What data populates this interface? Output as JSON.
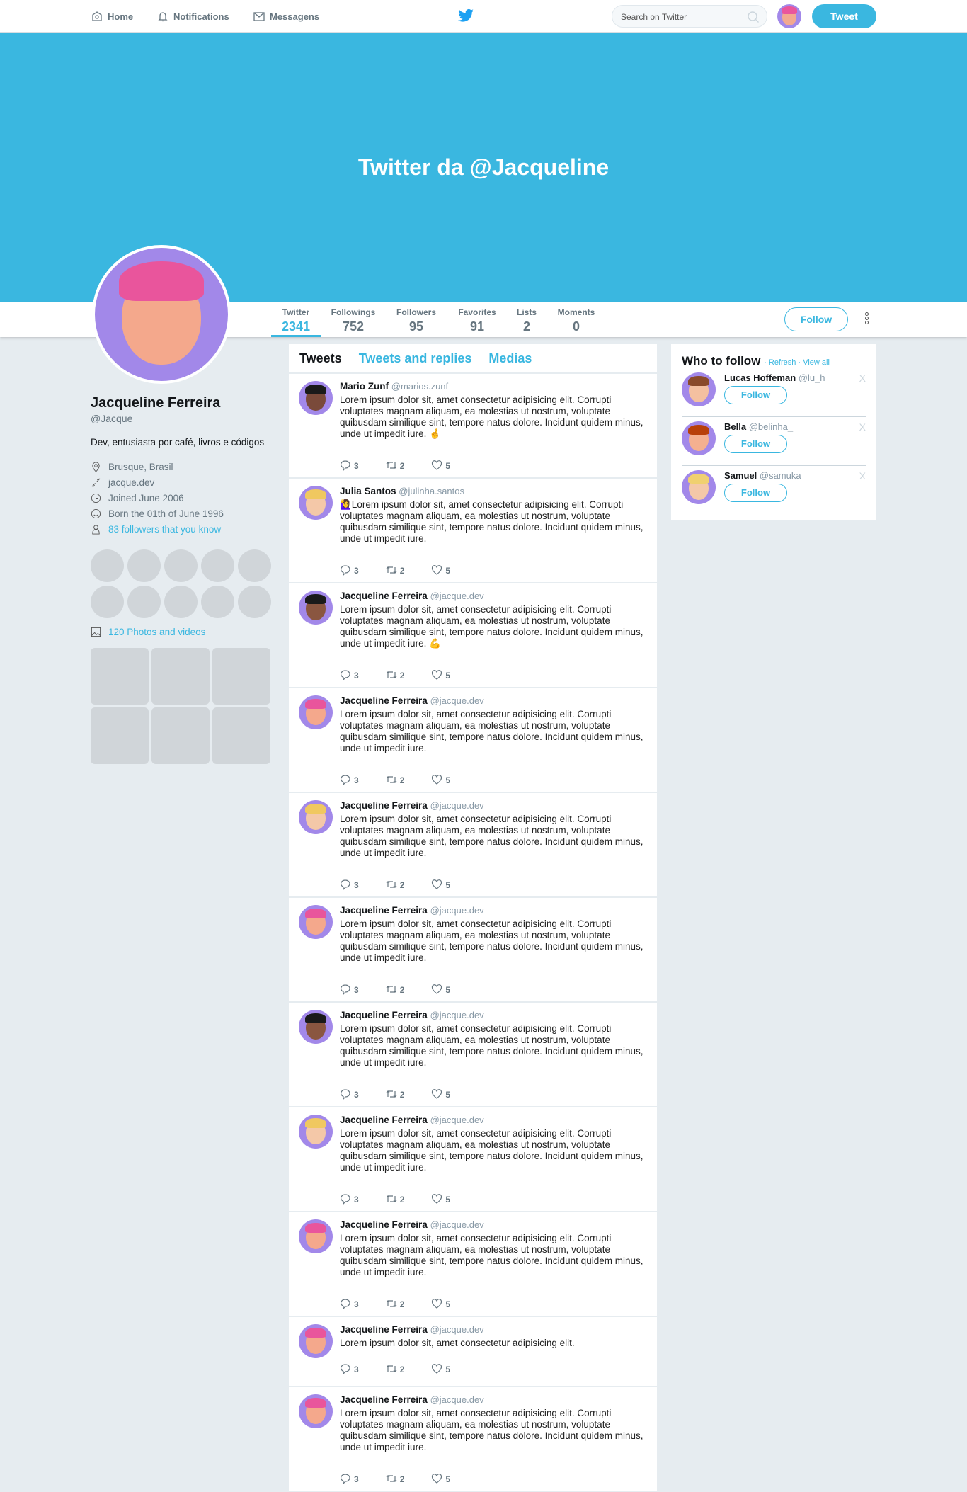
{
  "nav": {
    "home": "Home",
    "notifications": "Notifications",
    "messages": "Messagens",
    "search_placeholder": "Search on Twitter",
    "tweet": "Tweet"
  },
  "banner": {
    "title": "Twitter da @Jacqueline"
  },
  "stats": [
    {
      "label": "Twitter",
      "value": "2341"
    },
    {
      "label": "Followings",
      "value": "752"
    },
    {
      "label": "Followers",
      "value": "95"
    },
    {
      "label": "Favorites",
      "value": "91"
    },
    {
      "label": "Lists",
      "value": "2"
    },
    {
      "label": "Moments",
      "value": "0"
    }
  ],
  "follow": "Follow",
  "profile": {
    "name": "Jacqueline Ferreira",
    "handle": "@Jacque",
    "bio": "Dev, entusiasta por café, livros e códigos",
    "location": "Brusque, Brasil",
    "website": "jacque.dev",
    "joined": "Joined June 2006",
    "born": "Born the 01th of June 1996",
    "followers_you_know": "83 followers that you know",
    "photos": "120 Photos and videos"
  },
  "tabs": [
    "Tweets",
    "Tweets and replies",
    "Medias"
  ],
  "tweets": [
    {
      "name": "Mario Zunf",
      "handle": "@marios.zunf",
      "text": "Lorem ipsum dolor sit, amet consectetur adipisicing elit. Corrupti voluptates magnam aliquam, ea molestias ut nostrum, voluptate quibusdam similique sint, tempore natus dolore. Incidunt quidem minus, unde ut impedit iure. 🤞",
      "replies": "3",
      "retweets": "2",
      "likes": "5"
    },
    {
      "name": "Julia Santos",
      "handle": "@julinha.santos",
      "text": "🙋‍♀️Lorem ipsum dolor sit, amet consectetur adipisicing elit. Corrupti voluptates magnam aliquam, ea molestias ut nostrum, voluptate quibusdam similique sint, tempore natus dolore. Incidunt quidem minus, unde ut impedit iure.",
      "replies": "3",
      "retweets": "2",
      "likes": "5"
    },
    {
      "name": "Jacqueline Ferreira",
      "handle": "@jacque.dev",
      "text": "Lorem ipsum dolor sit, amet consectetur adipisicing elit. Corrupti voluptates magnam aliquam, ea molestias ut nostrum, voluptate quibusdam similique sint, tempore natus dolore. Incidunt quidem minus, unde ut impedit iure. 💪",
      "replies": "3",
      "retweets": "2",
      "likes": "5"
    },
    {
      "name": "Jacqueline Ferreira",
      "handle": "@jacque.dev",
      "text": "Lorem ipsum dolor sit, amet consectetur adipisicing elit. Corrupti voluptates magnam aliquam, ea molestias ut nostrum, voluptate quibusdam similique sint, tempore natus dolore. Incidunt quidem minus, unde ut impedit iure.",
      "replies": "3",
      "retweets": "2",
      "likes": "5"
    },
    {
      "name": "Jacqueline Ferreira",
      "handle": "@jacque.dev",
      "text": "Lorem ipsum dolor sit, amet consectetur adipisicing elit. Corrupti voluptates magnam aliquam, ea molestias ut nostrum, voluptate quibusdam similique sint, tempore natus dolore. Incidunt quidem minus, unde ut impedit iure.",
      "replies": "3",
      "retweets": "2",
      "likes": "5"
    },
    {
      "name": "Jacqueline Ferreira",
      "handle": "@jacque.dev",
      "text": "Lorem ipsum dolor sit, amet consectetur adipisicing elit. Corrupti voluptates magnam aliquam, ea molestias ut nostrum, voluptate quibusdam similique sint, tempore natus dolore. Incidunt quidem minus, unde ut impedit iure.",
      "replies": "3",
      "retweets": "2",
      "likes": "5"
    },
    {
      "name": "Jacqueline Ferreira",
      "handle": "@jacque.dev",
      "text": "Lorem ipsum dolor sit, amet consectetur adipisicing elit. Corrupti voluptates magnam aliquam, ea molestias ut nostrum, voluptate quibusdam similique sint, tempore natus dolore. Incidunt quidem minus, unde ut impedit iure.",
      "replies": "3",
      "retweets": "2",
      "likes": "5"
    },
    {
      "name": "Jacqueline Ferreira",
      "handle": "@jacque.dev",
      "text": "Lorem ipsum dolor sit, amet consectetur adipisicing elit. Corrupti voluptates magnam aliquam, ea molestias ut nostrum, voluptate quibusdam similique sint, tempore natus dolore. Incidunt quidem minus, unde ut impedit iure.",
      "replies": "3",
      "retweets": "2",
      "likes": "5"
    },
    {
      "name": "Jacqueline Ferreira",
      "handle": "@jacque.dev",
      "text": "Lorem ipsum dolor sit, amet consectetur adipisicing elit. Corrupti voluptates magnam aliquam, ea molestias ut nostrum, voluptate quibusdam similique sint, tempore natus dolore. Incidunt quidem minus, unde ut impedit iure.",
      "replies": "3",
      "retweets": "2",
      "likes": "5"
    },
    {
      "name": "Jacqueline Ferreira",
      "handle": "@jacque.dev",
      "text": "Lorem ipsum dolor sit, amet consectetur adipisicing elit.",
      "replies": "3",
      "retweets": "2",
      "likes": "5",
      "short": true
    },
    {
      "name": "Jacqueline Ferreira",
      "handle": "@jacque.dev",
      "text": "Lorem ipsum dolor sit, amet consectetur adipisicing elit. Corrupti voluptates magnam aliquam, ea molestias ut nostrum, voluptate quibusdam similique sint, tempore natus dolore. Incidunt quidem minus, unde ut impedit iure.",
      "replies": "3",
      "retweets": "2",
      "likes": "5"
    }
  ],
  "who_to_follow": {
    "title": "Who to follow",
    "refresh": "Refresh",
    "view_all": "View all",
    "dismiss": "X",
    "users": [
      {
        "name": "Lucas Hoffeman",
        "handle": "@lu_h"
      },
      {
        "name": "Bella",
        "handle": "@belinha_"
      },
      {
        "name": "Samuel",
        "handle": "@samuka"
      }
    ]
  },
  "colors": {
    "accent": "#3ab7e0",
    "avatar_bg": "#a288e9",
    "page_bg": "#e6ecf0"
  }
}
